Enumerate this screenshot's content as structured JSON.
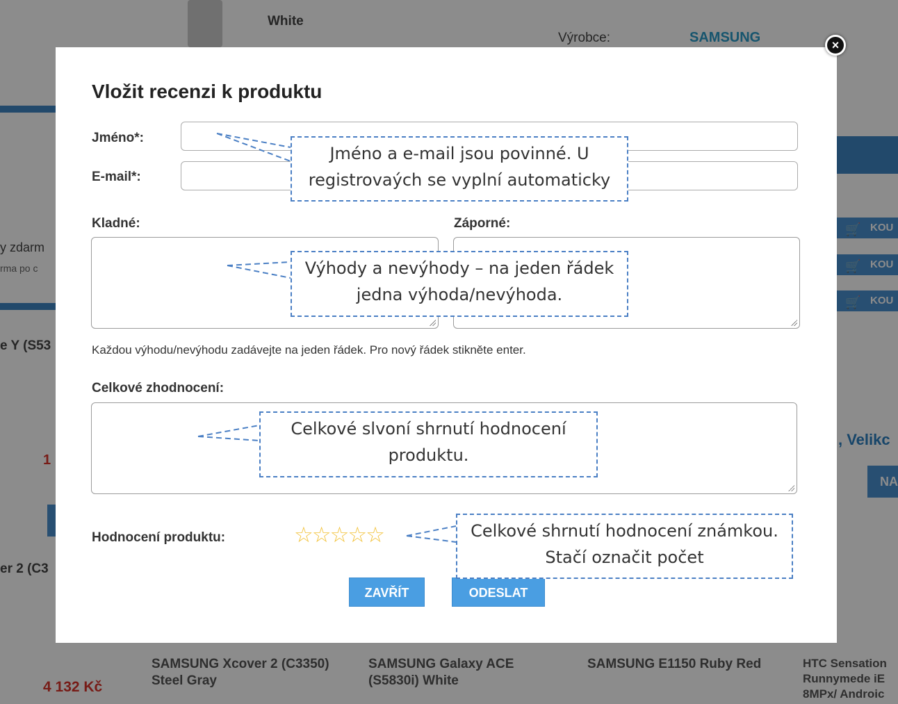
{
  "background": {
    "product_white": "White",
    "vyrobce_label": "Výrobce:",
    "vyrobce_value": "SAMSUNG",
    "left_zdarma": "y zdarm",
    "left_zdarma_sub": "rma po c",
    "left_model": "e Y (S53",
    "left_red": "1",
    "left_xcover": "er 2 (C3",
    "price": "4 132 Kč",
    "cart_labels": [
      "KOU",
      "KOU",
      "KOU"
    ],
    "right_velikost": ", Velikc",
    "right_btn": "NA",
    "bottom_products": [
      "SAMSUNG Xcover 2 (C3350) Steel Gray",
      "SAMSUNG Galaxy ACE (S5830i) White",
      "SAMSUNG E1150 Ruby Red",
      "HTC Sensation Runnymede iE 8MPx/ Androic"
    ]
  },
  "modal": {
    "title": "Vložit recenzi k produktu",
    "name_label": "Jméno*:",
    "email_label": "E-mail*:",
    "pros_label": "Kladné:",
    "cons_label": "Záporné:",
    "hint": "Každou výhodu/nevýhodu zadávejte na jeden řádek. Pro nový řádek stikněte enter.",
    "overall_label": "Celkové zhodnocení:",
    "rating_label": "Hodnocení produktu:",
    "rating_stars": "☆☆☆☆☆",
    "rating_value": 0,
    "rating_max": 5,
    "close_button": "ZAVŘÍT",
    "submit_button": "ODESLAT",
    "close_icon": "×"
  },
  "annotations": {
    "name_email": "Jméno a e-mail jsou povinné. U registrovaých se vyplní automaticky",
    "pros_cons": "Výhody a nevýhody – na jeden řádek jedna výhoda/nevýhoda.",
    "overall": "Celkové slvoní shrnutí hodnocení produktu.",
    "rating": "Celkové shrnutí hodnocení známkou. Stačí označit počet"
  },
  "colors": {
    "accent_blue": "#4a9ee2",
    "star_yellow": "#f2c23a",
    "callout_border": "#4a7fc4",
    "price_red": "#d9342b"
  }
}
